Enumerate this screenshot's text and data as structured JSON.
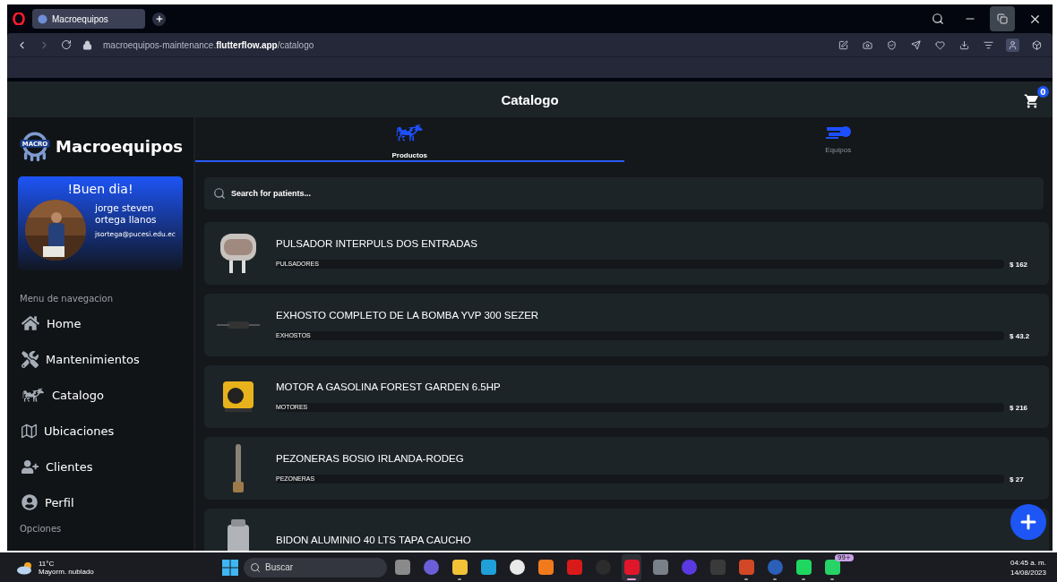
{
  "browser": {
    "tab_title": "Macroequipos",
    "url": "macroequipos-maintenance.**flutterflow.app**/catalogo"
  },
  "header": {
    "title": "Catalogo",
    "cart_count": "0"
  },
  "sidebar": {
    "logo_text": "MACRO",
    "brand": "Macroequipos",
    "greeting": "!Buen dia!",
    "user_name": "jorge steven ortega llanos",
    "email": "jsortega@pucesi.edu.ec",
    "section_title": "Menu de navegacion",
    "items": [
      {
        "kind": "home",
        "label": "Home"
      },
      {
        "kind": "tools",
        "label": "Mantenimientos"
      },
      {
        "kind": "cow",
        "label": "Catalogo"
      },
      {
        "kind": "map",
        "label": "Ubicaciones"
      },
      {
        "kind": "clients",
        "label": "Clientes"
      },
      {
        "kind": "profile",
        "label": "Perfil"
      }
    ],
    "footer_title": "Opciones"
  },
  "tabs": [
    {
      "kind": "cow",
      "label": "Productos",
      "selected": true
    },
    {
      "kind": "machine",
      "label": "Equipos",
      "selected": false
    }
  ],
  "search": {
    "placeholder": "Search for patients..."
  },
  "products": [
    {
      "kind": "picture",
      "name": "PULSADOR INTERPULS DOS ENTRADAS",
      "category": "PULSADORES",
      "price": "162"
    },
    {
      "kind": "picture",
      "name": "EXHOSTO COMPLETO DE LA BOMBA YVP 300 SEZER",
      "category": "EXHOSTOS",
      "price": "43.2"
    },
    {
      "kind": "picture",
      "name": "MOTOR A GASOLINA FOREST GARDEN 6.5HP",
      "category": "MOTORES",
      "price": "216"
    },
    {
      "kind": "picture",
      "name": "PEZONERAS BOSIO IRLANDA-RODEG",
      "category": "PEZONERAS",
      "price": "27"
    },
    {
      "kind": "picture",
      "name": "BIDON ALUMINIO 40 LTS TAPA CAUCHO"
    }
  ],
  "price_symbol": "$",
  "taskbar": {
    "temperature": "11°C",
    "weather": "Mayorm. nublado",
    "search_placeholder": "Buscar",
    "time": "04:45 a. m.",
    "date": "14/08/2023",
    "apps": [
      {
        "color": "#8a8a8a",
        "running": false,
        "selected": false
      },
      {
        "color": "#6a5fd8",
        "running": false,
        "selected": false
      },
      {
        "color": "#f2c237",
        "running": true,
        "selected": false
      },
      {
        "color": "#1fa0d8",
        "running": false,
        "selected": false
      },
      {
        "color": "#e9e9e9",
        "running": false,
        "selected": false
      },
      {
        "color": "#f07a1c",
        "running": false,
        "selected": false
      },
      {
        "color": "#d81a1a",
        "running": false,
        "selected": false
      },
      {
        "color": "#2c2c2c",
        "running": false,
        "selected": false
      },
      {
        "color": "#e0162b",
        "running": true,
        "selected": true
      },
      {
        "color": "#7a8088",
        "running": false,
        "selected": false
      },
      {
        "color": "#5a3ae0",
        "running": false,
        "selected": false
      },
      {
        "color": "#3a3a3a",
        "running": false,
        "selected": false
      },
      {
        "color": "#d24726",
        "running": true,
        "selected": false
      },
      {
        "color": "#2b5fb8",
        "running": true,
        "selected": false
      },
      {
        "color": "#1ed760",
        "running": true,
        "selected": false
      },
      {
        "color": "#25d366",
        "running": true,
        "selected": false,
        "badge": "99+"
      }
    ]
  }
}
